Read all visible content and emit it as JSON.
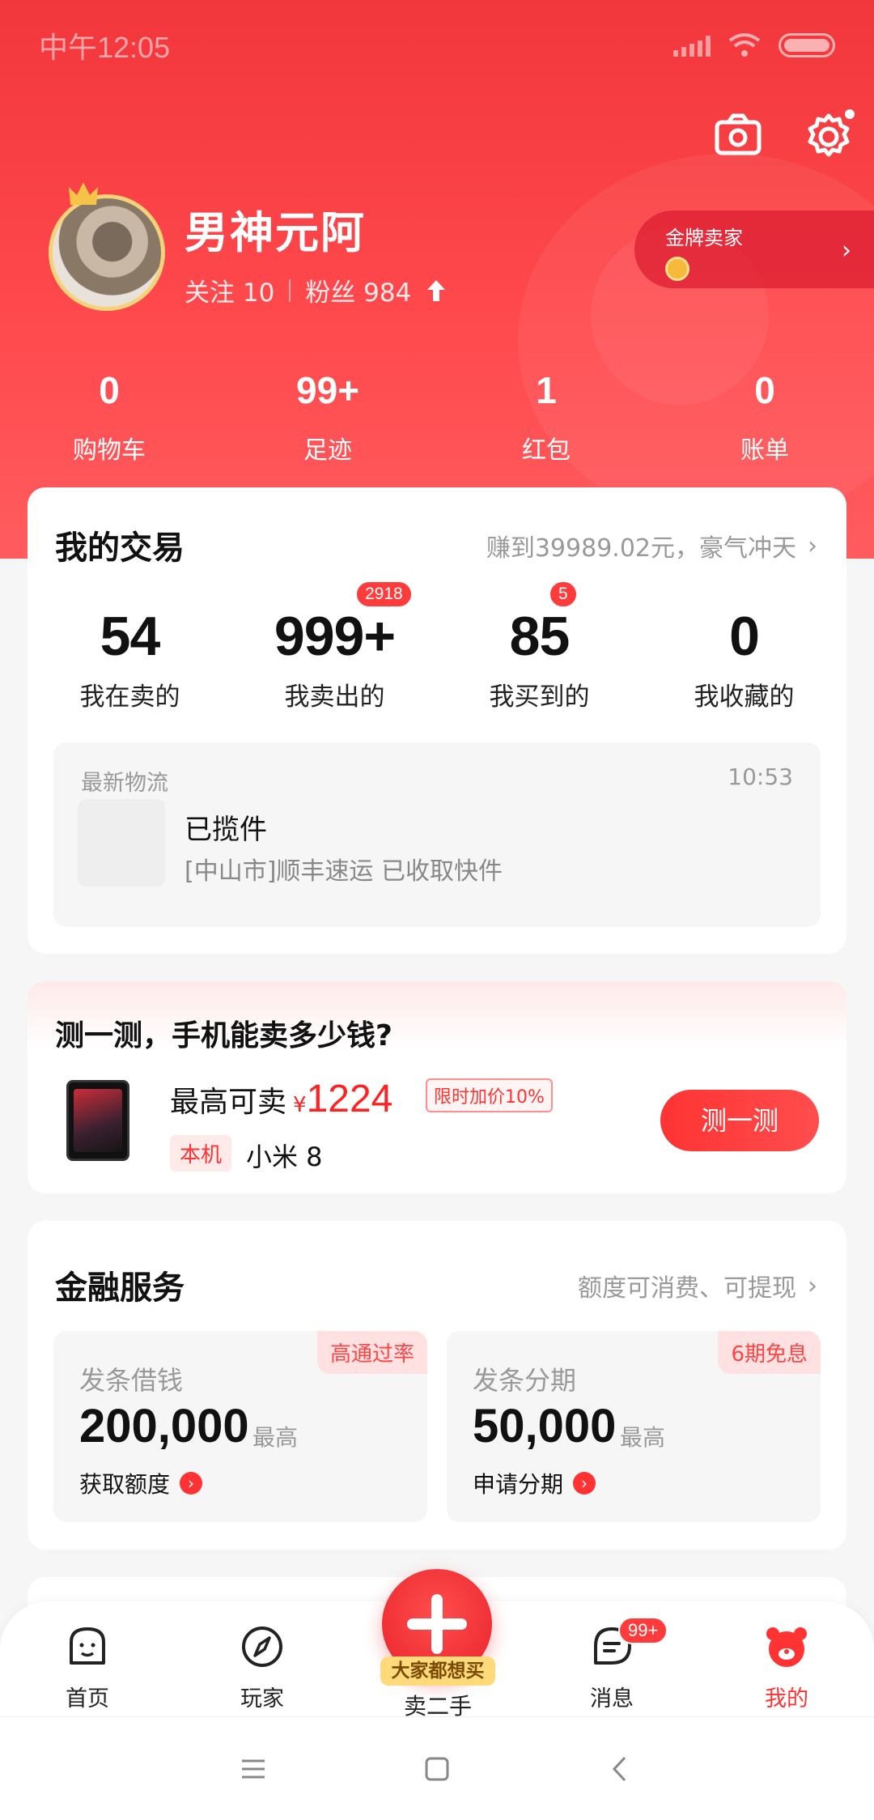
{
  "statusbar": {
    "time": "中午12:05"
  },
  "profile": {
    "name": "男神元阿",
    "follow": "关注 10",
    "fans": "粉丝 984"
  },
  "seller": {
    "label": "金牌卖家"
  },
  "counts": [
    {
      "value": "0",
      "label": "购物车"
    },
    {
      "value": "99+",
      "label": "足迹"
    },
    {
      "value": "1",
      "label": "红包"
    },
    {
      "value": "0",
      "label": "账单"
    }
  ],
  "trade": {
    "title": "我的交易",
    "summary": "赚到39989.02元，豪气冲天",
    "items": [
      {
        "value": "54",
        "label": "我在卖的",
        "badge": ""
      },
      {
        "value": "999+",
        "label": "我卖出的",
        "badge": "2918"
      },
      {
        "value": "85",
        "label": "我买到的",
        "badge": "5"
      },
      {
        "value": "0",
        "label": "我收藏的",
        "badge": ""
      }
    ],
    "logistics": {
      "header": "最新物流",
      "time": "10:53",
      "status": "已揽件",
      "detail": "[中山市]顺丰速运 已收取快件"
    }
  },
  "estimate": {
    "title": "测一测，手机能卖多少钱?",
    "price_prefix": "最高可卖",
    "currency": "¥",
    "price": "1224",
    "promo": "限时加价10%",
    "device_tag": "本机",
    "model": "小米 8",
    "button": "测一测"
  },
  "finance": {
    "title": "金融服务",
    "summary": "额度可消费、可提现",
    "cards": [
      {
        "badge": "高通过率",
        "name": "发条借钱",
        "amount": "200,000",
        "max": "最高",
        "action": "获取额度"
      },
      {
        "badge": "6期免息",
        "name": "发条分期",
        "amount": "50,000",
        "max": "最高",
        "action": "申请分期"
      }
    ]
  },
  "tabs": [
    {
      "label": "首页",
      "icon": "home-face-icon"
    },
    {
      "label": "玩家",
      "icon": "compass-icon"
    },
    {
      "label": "卖二手",
      "icon": "plus-icon",
      "badge": "大家都想买"
    },
    {
      "label": "消息",
      "icon": "message-icon",
      "badge": "99+"
    },
    {
      "label": "我的",
      "icon": "bear-icon"
    }
  ],
  "colors": {
    "brand": "#ff3b3b",
    "accent_gold": "#ffd97a"
  }
}
